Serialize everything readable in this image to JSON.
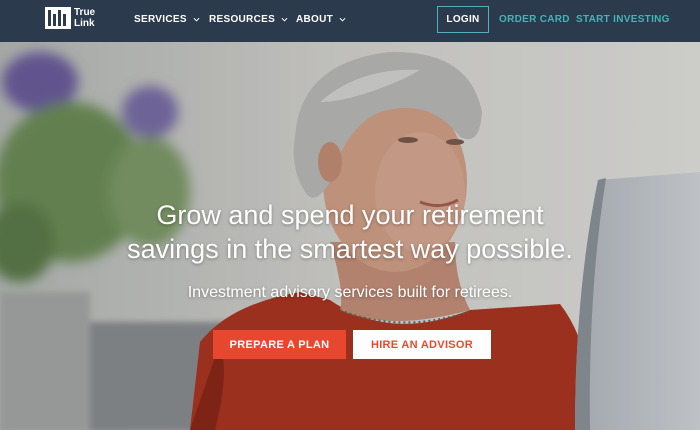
{
  "header": {
    "logo_line1": "True",
    "logo_line2": "Link",
    "nav": {
      "services": "SERVICES",
      "resources": "RESOURCES",
      "about": "ABOUT"
    },
    "login": "LOGIN",
    "order_card": "ORDER CARD",
    "start_investing": "START INVESTING"
  },
  "hero": {
    "headline_line1": "Grow and spend your retirement",
    "headline_line2": "savings in the smartest way possible.",
    "subheadline": "Investment advisory services built for retirees.",
    "primary_cta": "PREPARE A PLAN",
    "secondary_cta": "HIRE AN ADVISOR"
  },
  "colors": {
    "header_bg": "#2b3a4c",
    "accent_teal": "#46b3b8",
    "cta_red": "#e8472f"
  }
}
